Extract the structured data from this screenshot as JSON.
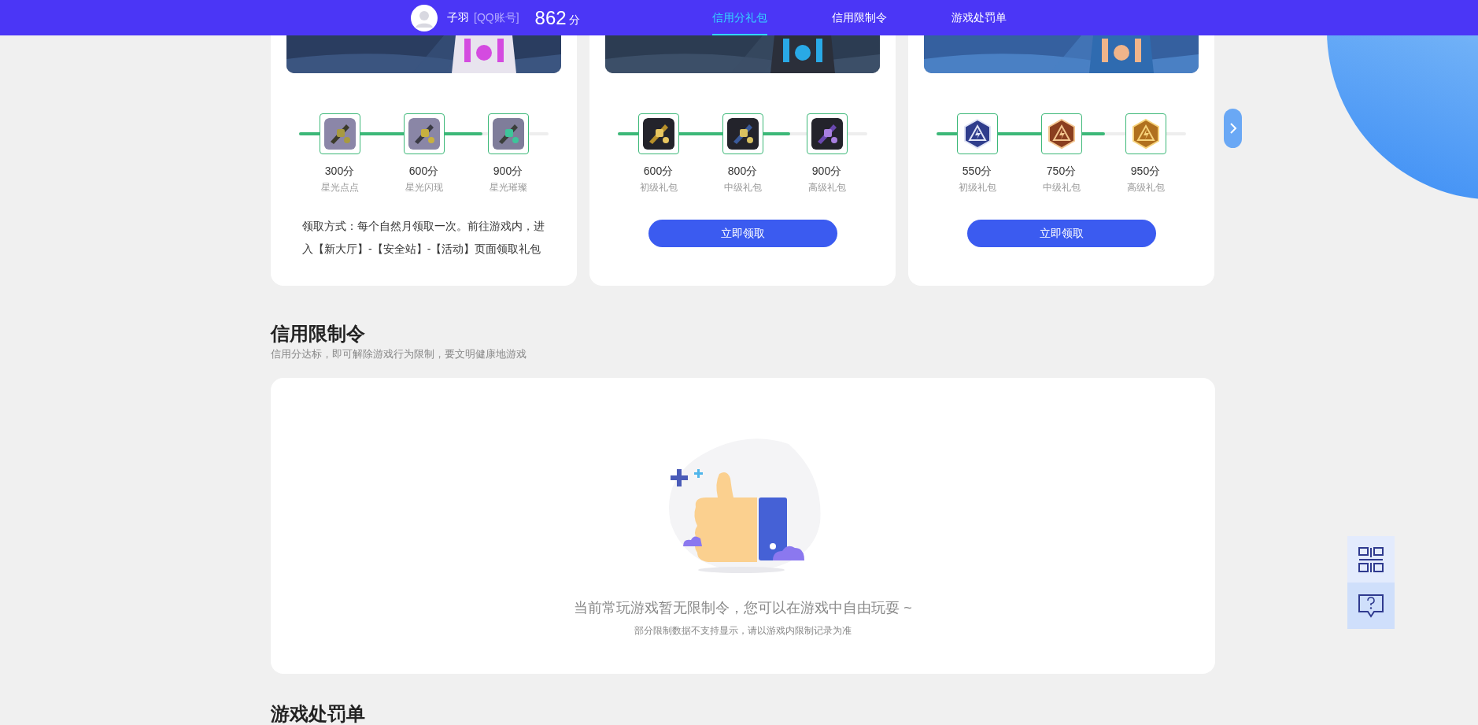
{
  "header": {
    "username": "子羽",
    "account_label": "[QQ账号]",
    "score": "862",
    "score_unit": "分",
    "tabs": [
      {
        "label": "信用分礼包",
        "selected": true
      },
      {
        "label": "信用限制令",
        "selected": false
      },
      {
        "label": "游戏处罚单",
        "selected": false
      }
    ]
  },
  "gift_cards": [
    {
      "kind": "instructions",
      "level": 0.735,
      "rewards": [
        {
          "score": "300分",
          "name": "星光点点"
        },
        {
          "score": "600分",
          "name": "星光闪现"
        },
        {
          "score": "900分",
          "name": "星光璀璨"
        }
      ],
      "instructions": "领取方式：每个自然月领取一次。前往游戏内，进入【新大厅】-【安全站】-【活动】页面领取礼包"
    },
    {
      "kind": "button",
      "level": 0.69,
      "rewards": [
        {
          "score": "600分",
          "name": "初级礼包"
        },
        {
          "score": "800分",
          "name": "中级礼包"
        },
        {
          "score": "900分",
          "name": "高级礼包"
        }
      ],
      "button": "立即领取"
    },
    {
      "kind": "button",
      "level": 0.675,
      "rewards": [
        {
          "score": "550分",
          "name": "初级礼包"
        },
        {
          "score": "750分",
          "name": "中级礼包"
        },
        {
          "score": "950分",
          "name": "高级礼包"
        }
      ],
      "button": "立即领取"
    }
  ],
  "restriction_section": {
    "title": "信用限制令",
    "subtitle": "信用分达标，即可解除游戏行为限制，要文明健康地游戏",
    "empty_message": "当前常玩游戏暂无限制令，您可以在游戏中自由玩耍 ~",
    "empty_note": "部分限制数据不支持显示，请以游戏内限制记录为准"
  },
  "penalty_section": {
    "title": "游戏处罚单"
  }
}
